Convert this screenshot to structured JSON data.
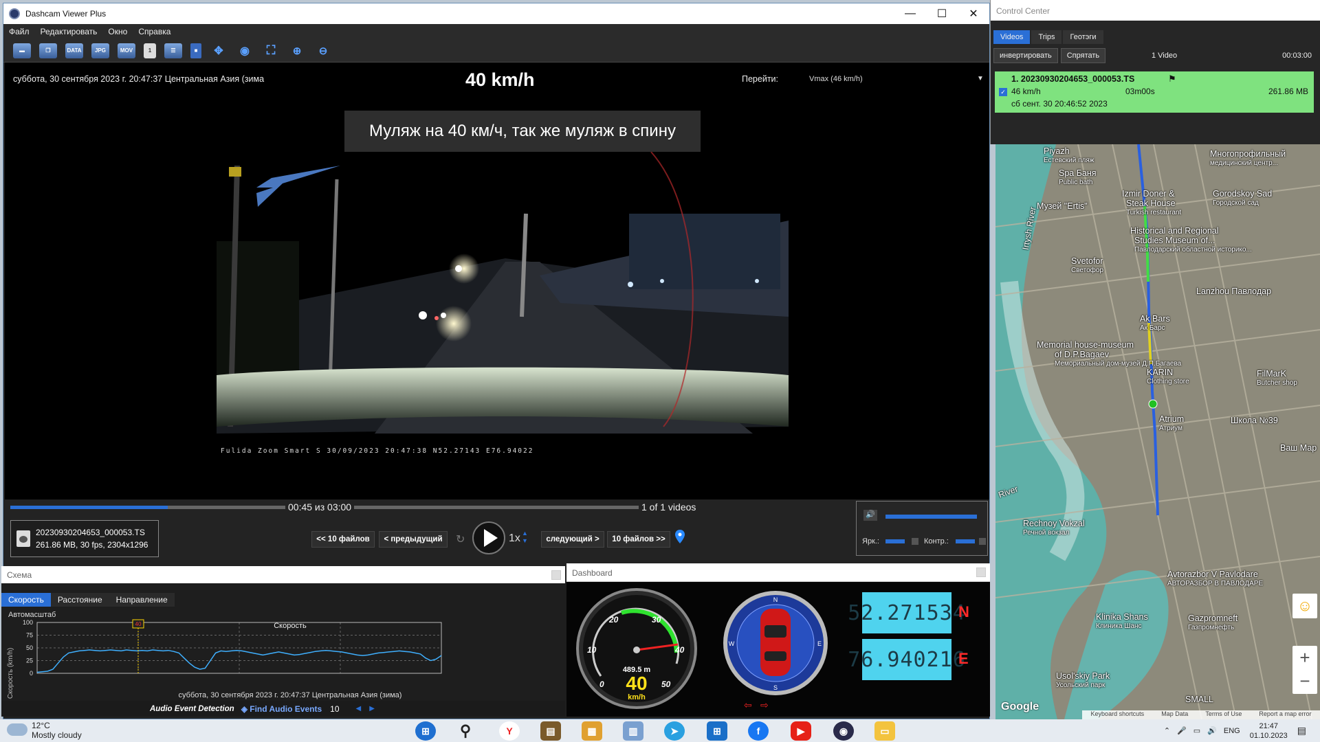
{
  "window": {
    "title": "Dashcam Viewer Plus",
    "minimize": "—",
    "maximize": "☐",
    "close": "✕"
  },
  "menu": [
    "Файл",
    "Редактировать",
    "Окно",
    "Справка"
  ],
  "toolbar": [
    {
      "name": "open-folder-icon",
      "label": ""
    },
    {
      "name": "copy-files-icon",
      "label": ""
    },
    {
      "name": "export-data-icon",
      "label": "DATA"
    },
    {
      "name": "export-jpg-icon",
      "label": "JPG"
    },
    {
      "name": "export-mov-icon",
      "label": "MOV"
    },
    {
      "name": "single-view-icon",
      "label": "1"
    },
    {
      "name": "playlist-icon",
      "label": ""
    },
    {
      "name": "lock-icon",
      "label": ""
    },
    {
      "name": "move-icon",
      "label": ""
    },
    {
      "name": "record-icon",
      "label": ""
    },
    {
      "name": "fit-screen-icon",
      "label": ""
    },
    {
      "name": "zoom-in-icon",
      "label": ""
    },
    {
      "name": "zoom-out-icon",
      "label": ""
    }
  ],
  "video": {
    "datetime": "суббота, 30 сентября 2023 г. 20:47:37 Центральная Азия (зима",
    "speed": "40 km/h",
    "goto_label": "Перейти:",
    "goto_value": "Vmax (46 km/h)",
    "caption": "Муляж на 40 км/ч, так же муляж в спину",
    "osd": "Fulida Zoom Smart S 30/09/2023 20:47:38 N52.27143 E76.94022"
  },
  "transport": {
    "time": "00:45 из 03:00",
    "progress": 0.25,
    "of_videos": "1 of 1 videos",
    "file_name": "20230930204653_000053.TS",
    "file_info": "261.86 MB, 30 fps, 2304x1296",
    "back10": "<< 10 файлов",
    "prev": "< предыдущий",
    "rate": "1x",
    "next": "следующий >",
    "fwd10": "10 файлов >>",
    "brightness": "Ярк.:",
    "contrast": "Контр.:",
    "volume": 0.95
  },
  "schema": {
    "title": "Схема",
    "tabs": [
      "Скорость",
      "Расстояние",
      "Направление"
    ],
    "autoscale": "Автомасштаб"
  },
  "chart_data": {
    "type": "line",
    "title": "Скорость",
    "xlabel": "суббота, 30 сентября 2023 г. 20:47:37 Центральная Азия (зима)",
    "ylabel": "Скорость (km/h)",
    "ylim": [
      0,
      100
    ],
    "yticks": [
      "100",
      "75",
      "50",
      "25",
      "0"
    ],
    "marker_label": "40",
    "marker_x": 0.25,
    "values": [
      2,
      3,
      4,
      8,
      20,
      32,
      40,
      42,
      44,
      45,
      46,
      45,
      44,
      45,
      46,
      45,
      44,
      46,
      45,
      44,
      45,
      44,
      46,
      45,
      44,
      45,
      43,
      40,
      30,
      20,
      12,
      8,
      10,
      25,
      40,
      44,
      43,
      44,
      45,
      44,
      42,
      40,
      38,
      36,
      38,
      40,
      42,
      40,
      38,
      36,
      37,
      39,
      41,
      43,
      44,
      45,
      44,
      43,
      42,
      40,
      38,
      36,
      35,
      36,
      38,
      40,
      41,
      42,
      43,
      44,
      43,
      42,
      40,
      38,
      30,
      25,
      28,
      35
    ]
  },
  "audio": {
    "label": "Audio Event Detection",
    "find": "Find Audio Events",
    "value": "10"
  },
  "dashboard": {
    "title": "Dashboard",
    "gauge_ticks": [
      "0",
      "10",
      "20",
      "30",
      "40",
      "50"
    ],
    "distance": "489.5 m",
    "speed": "40",
    "unit": "km/h",
    "lat": "52.271534",
    "lat_dir": "N",
    "lon": "76.940216",
    "lon_dir": "E",
    "compass": [
      "N",
      "E",
      "S",
      "W"
    ]
  },
  "control_center": {
    "title": "Control Center",
    "tabs": [
      "Videos",
      "Trips",
      "Геотэги"
    ],
    "buttons": [
      "инвертировать",
      "Спрятать"
    ],
    "count": "1 Video",
    "duration": "00:03:00",
    "item": {
      "name": "1. 20230930204653_000053.TS",
      "speed": "46 km/h",
      "length": "03m00s",
      "size": "261.86 MB",
      "date": "сб сент. 30 20:46:52 2023"
    }
  },
  "map": {
    "labels": [
      {
        "t": "Piyazh",
        "s": "Естевский пляж"
      },
      {
        "t": "Spa Баня",
        "s": "Public bath"
      },
      {
        "t": "Музей \"Ertis\"",
        "s": ""
      },
      {
        "t": "Izmir Doner &",
        "s": ""
      },
      {
        "t": "Steak House",
        "s": "Turkish restaurant"
      },
      {
        "t": "Многопрофильный",
        "s": "медицинский центр..."
      },
      {
        "t": "Gorodskoy Sad",
        "s": "Городской сад"
      },
      {
        "t": "Historical and Regional",
        "s": ""
      },
      {
        "t": "Studies Museum of...",
        "s": "Павлодарский областной историко..."
      },
      {
        "t": "Svetofor",
        "s": "Светофор"
      },
      {
        "t": "Lanzhou Павлодар",
        "s": ""
      },
      {
        "t": "Ak Bars",
        "s": "Ак Барс"
      },
      {
        "t": "Memorial house-museum",
        "s": ""
      },
      {
        "t": "of D.P.Bagaev",
        "s": "Мемориальный дом-музей Д.П.Багаева"
      },
      {
        "t": "KARIN",
        "s": "Clothing store"
      },
      {
        "t": "FilMarK",
        "s": "Butcher shop"
      },
      {
        "t": "Atrium",
        "s": "Атриум"
      },
      {
        "t": "Школа №39",
        "s": ""
      },
      {
        "t": "Ваш Мар",
        "s": ""
      },
      {
        "t": "Rechnoy Vokzal",
        "s": "Речной вокзал"
      },
      {
        "t": "Avtorazbor V Pavlodare",
        "s": "АВТОРАЗБОР В ПАВЛОДАРЕ"
      },
      {
        "t": "Klinika Shans",
        "s": "Клиника Шанс"
      },
      {
        "t": "Gazpromneft",
        "s": "Газпромнефть"
      },
      {
        "t": "Usol'skiy Park",
        "s": "Усольский парк"
      },
      {
        "t": "SMALL",
        "s": ""
      },
      {
        "t": "Irtysh River",
        "s": ""
      },
      {
        "t": "River",
        "s": ""
      }
    ],
    "google": "Google",
    "footer": [
      "Keyboard shortcuts",
      "Map Data",
      "Terms of Use",
      "Report a map error"
    ],
    "zoom_in": "+",
    "zoom_out": "−"
  },
  "taskbar": {
    "temp": "12°C",
    "weather": "Mostly cloudy",
    "lang": "ENG",
    "time": "21:47",
    "date": "01.10.2023"
  }
}
